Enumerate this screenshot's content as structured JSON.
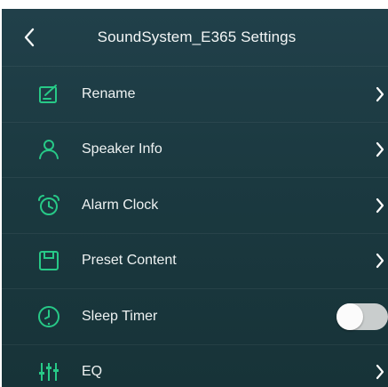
{
  "header": {
    "title": "SoundSystem_E365 Settings",
    "back_icon": "chevron-left-icon"
  },
  "colors": {
    "background_top": "#21404a",
    "background_bottom": "#173338",
    "icon_accent": "#27c987",
    "text": "#eef2f2",
    "toggle_track": "#c9cdcd"
  },
  "menu": {
    "items": [
      {
        "label": "Rename",
        "icon": "edit-icon",
        "control": "chevron"
      },
      {
        "label": "Speaker Info",
        "icon": "user-icon",
        "control": "chevron"
      },
      {
        "label": "Alarm Clock",
        "icon": "alarm-clock-icon",
        "control": "chevron"
      },
      {
        "label": "Preset Content",
        "icon": "preset-icon",
        "control": "chevron"
      },
      {
        "label": "Sleep Timer",
        "icon": "sleep-timer-icon",
        "control": "toggle",
        "enabled": false
      },
      {
        "label": "EQ",
        "icon": "equalizer-icon",
        "control": "chevron"
      }
    ]
  }
}
